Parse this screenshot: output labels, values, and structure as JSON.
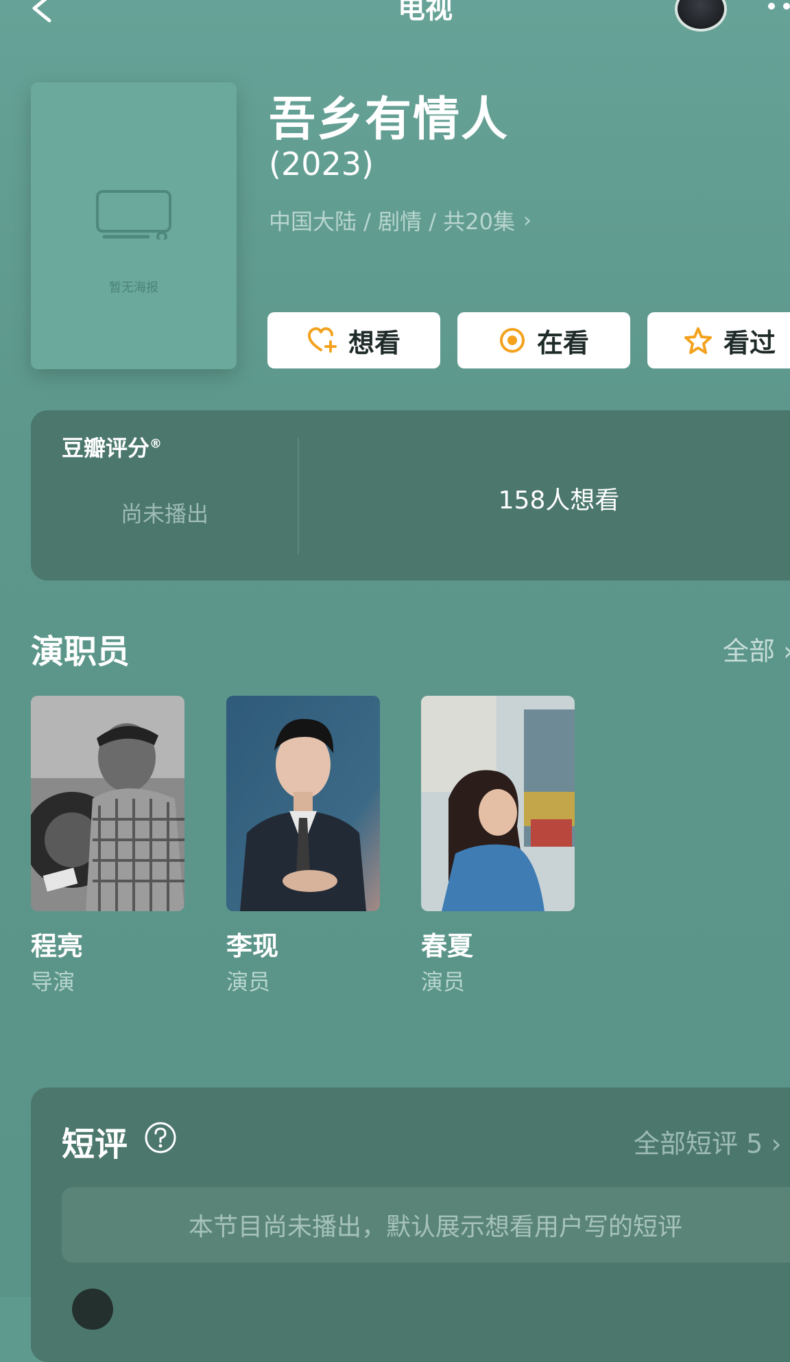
{
  "header": {
    "title": "电视"
  },
  "poster": {
    "placeholder_text": "暂无海报"
  },
  "show": {
    "title": "吾乡有情人",
    "year": "(2023)",
    "meta": "中国大陆 / 剧情 / 共20集"
  },
  "actions": [
    {
      "label": "想看",
      "icon": "heart-plus-icon"
    },
    {
      "label": "在看",
      "icon": "target-icon"
    },
    {
      "label": "看过",
      "icon": "star-icon"
    }
  ],
  "rating": {
    "label": "豆瓣评分",
    "registered": "®",
    "status": "尚未播出",
    "want_count": "158人想看"
  },
  "cast": {
    "title": "演职员",
    "all_label": "全部",
    "members": [
      {
        "name": "程亮",
        "role": "导演"
      },
      {
        "name": "李现",
        "role": "演员"
      },
      {
        "name": "春夏",
        "role": "演员"
      }
    ]
  },
  "reviews": {
    "title": "短评",
    "all_label": "全部短评 5",
    "notice": "本节目尚未播出，默认展示想看用户写的短评"
  },
  "colors": {
    "background": "#5f9a8e",
    "panel": "#4c776d",
    "accent_orange": "#f4a21e"
  }
}
